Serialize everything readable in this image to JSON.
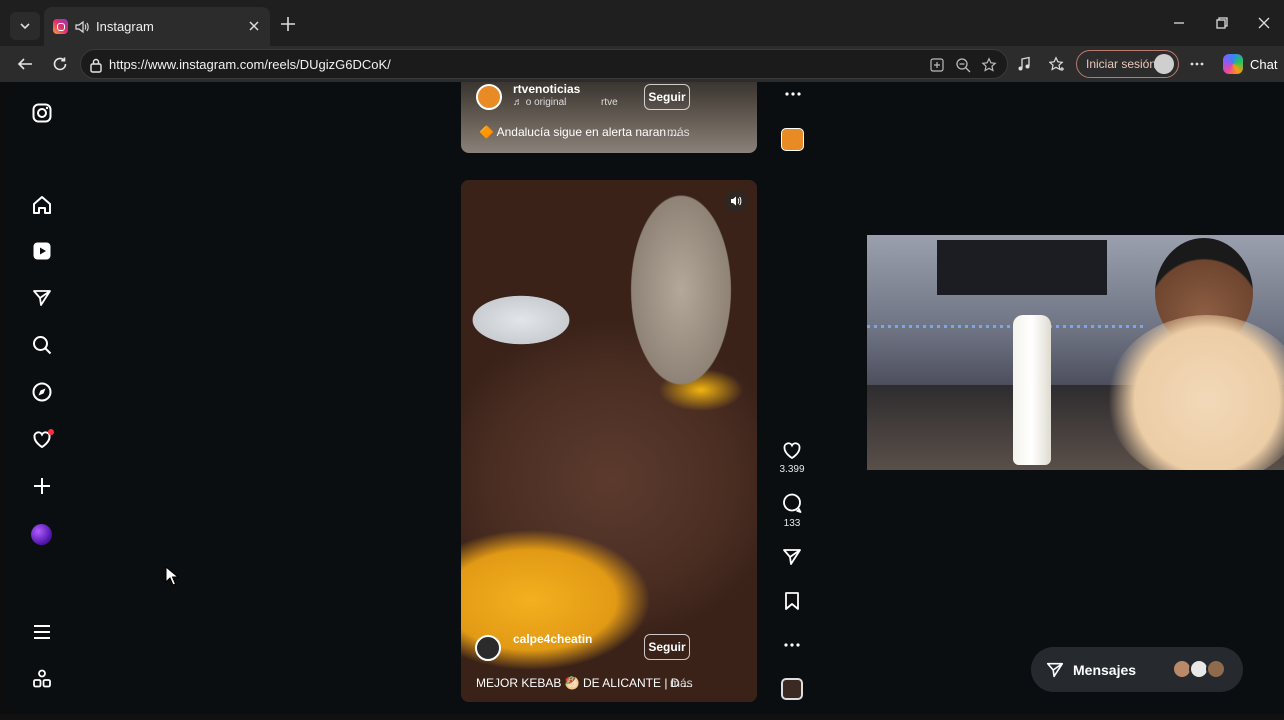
{
  "browser": {
    "tab_title": "Instagram",
    "url": "https://www.instagram.com/reels/DUgizG6DCoK/",
    "signin_label": "Iniciar sesión",
    "copilot_label": "Chat"
  },
  "reels": {
    "top": {
      "username": "rtvenoticias",
      "audio": "♬ o original",
      "audio_extra": "rtve",
      "follow_label": "Seguir",
      "caption": "🔶 Andalucía sigue en alerta naran ...",
      "more": "más"
    },
    "main": {
      "username": "calpe4cheatin",
      "follow_label": "Seguir",
      "caption": "MEJOR KEBAB 🥙 DE ALICANTE | D ...",
      "more": "más",
      "likes": "3.399",
      "comments": "133"
    }
  },
  "messages": {
    "label": "Mensajes",
    "avatar_colors": [
      "#b98a6a",
      "#e8e8e8",
      "#8f6a4d"
    ]
  },
  "colors": {
    "notification": "#ff3040",
    "signin_border": "#b97a6a"
  }
}
